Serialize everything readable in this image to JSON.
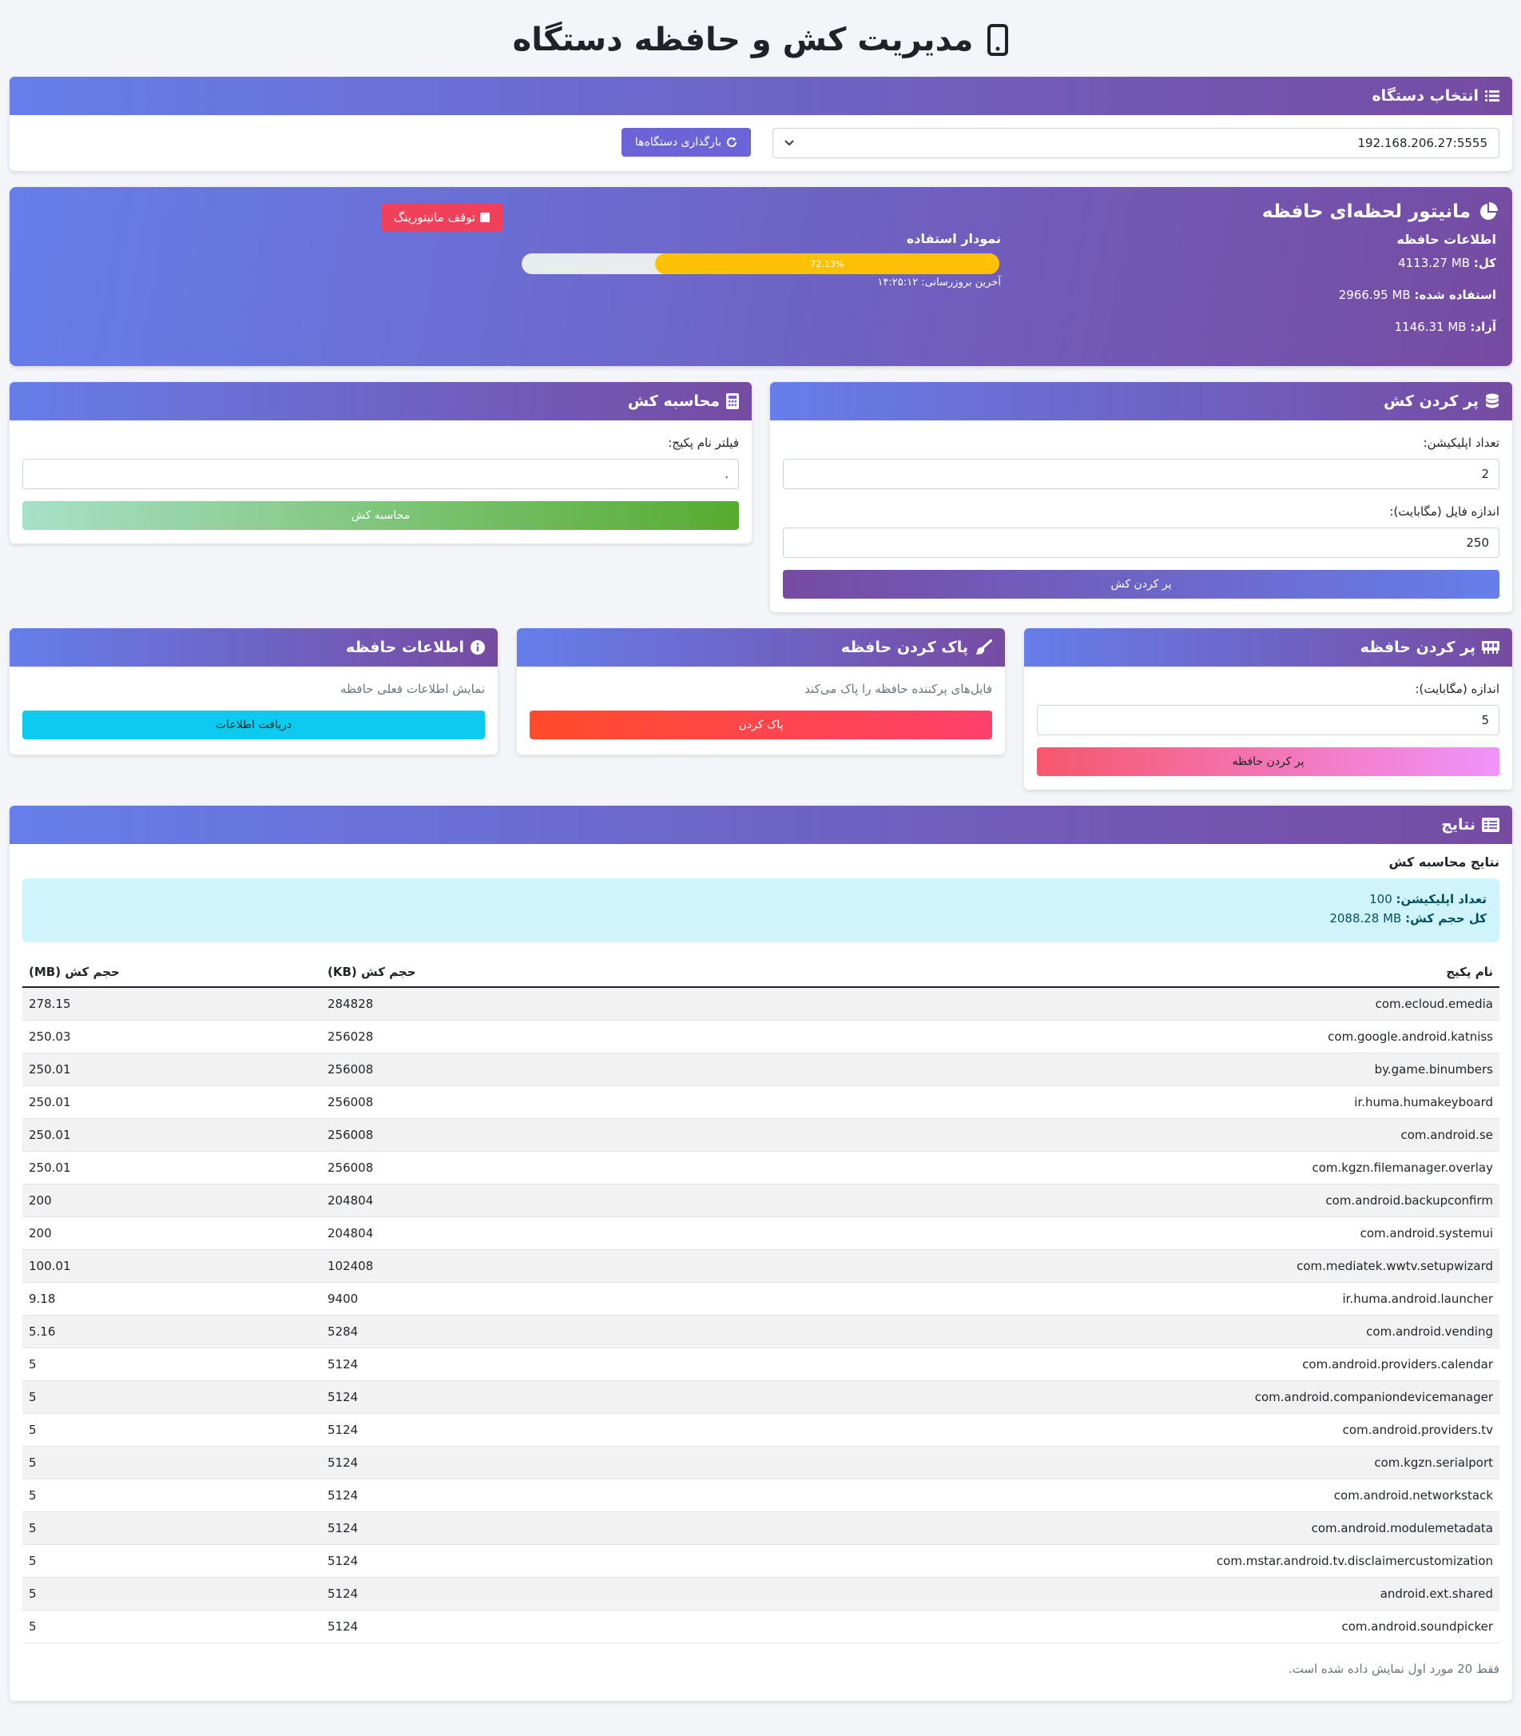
{
  "title": "مدیریت کش و حافظه دستگاه",
  "device": {
    "header": "انتخاب دستگاه",
    "selected": "192.168.206.27:5555",
    "reload_label": "بارگذاری دستگاه‌ها"
  },
  "monitor": {
    "title": "مانیتور لحظه‌ای حافظه",
    "info_heading": "اطلاعات حافظه",
    "total_label": "کل:",
    "total_value": "4113.27 MB",
    "used_label": "استفاده شده:",
    "used_value": "2966.95 MB",
    "free_label": "آزاد:",
    "free_value": "1146.31 MB",
    "chart_label": "نمودار استفاده",
    "usage_percent": 72.13,
    "usage_text": "72.13%",
    "last_update": "آخرین بروزرسانی: ۱۴:۲۵:۱۲",
    "stop_label": "توقف مانیتورینگ"
  },
  "fill_cache": {
    "header": "پر کردن کش",
    "app_count_label": "تعداد اپلیکیشن:",
    "app_count_value": "2",
    "file_size_label": "اندازه فایل (مگابایت):",
    "file_size_value": "250",
    "button": "پر کردن کش"
  },
  "calc_cache": {
    "header": "محاسبه کش",
    "filter_label": "فیلتر نام پکیج:",
    "filter_value": ".",
    "button": "محاسبه کش"
  },
  "fill_memory": {
    "header": "پر کردن حافظه",
    "size_label": "اندازه (مگابایت):",
    "size_value": "5",
    "button": "پر کردن حافظه"
  },
  "clear_memory": {
    "header": "پاک کردن حافظه",
    "description": "فایل‌های پرکننده حافظه را پاک می‌کند",
    "button": "پاک کردن"
  },
  "memory_info": {
    "header": "اطلاعات حافظه",
    "description": "نمایش اطلاعات فعلی حافظه",
    "button": "دریافت اطلاعات"
  },
  "results": {
    "header": "نتایج",
    "subtitle": "نتایج محاسبه کش",
    "app_count_label": "تعداد اپلیکیشن:",
    "app_count_value": "100",
    "total_label": "کل حجم کش:",
    "total_value": "2088.28 MB",
    "columns": [
      "نام پکیج",
      "حجم کش (KB)",
      "حجم کش (MB)"
    ],
    "rows": [
      [
        "com.ecloud.emedia",
        "284828",
        "278.15"
      ],
      [
        "com.google.android.katniss",
        "256028",
        "250.03"
      ],
      [
        "by.game.binumbers",
        "256008",
        "250.01"
      ],
      [
        "ir.huma.humakeyboard",
        "256008",
        "250.01"
      ],
      [
        "com.android.se",
        "256008",
        "250.01"
      ],
      [
        "com.kgzn.filemanager.overlay",
        "256008",
        "250.01"
      ],
      [
        "com.android.backupconfirm",
        "204804",
        "200"
      ],
      [
        "com.android.systemui",
        "204804",
        "200"
      ],
      [
        "com.mediatek.wwtv.setupwizard",
        "102408",
        "100.01"
      ],
      [
        "ir.huma.android.launcher",
        "9400",
        "9.18"
      ],
      [
        "com.android.vending",
        "5284",
        "5.16"
      ],
      [
        "com.android.providers.calendar",
        "5124",
        "5"
      ],
      [
        "com.android.companiondevicemanager",
        "5124",
        "5"
      ],
      [
        "com.android.providers.tv",
        "5124",
        "5"
      ],
      [
        "com.kgzn.serialport",
        "5124",
        "5"
      ],
      [
        "com.android.networkstack",
        "5124",
        "5"
      ],
      [
        "com.android.modulemetadata",
        "5124",
        "5"
      ],
      [
        "com.mstar.android.tv.disclaimercustomization",
        "5124",
        "5"
      ],
      [
        "android.ext.shared",
        "5124",
        "5"
      ],
      [
        "com.android.soundpicker",
        "5124",
        "5"
      ]
    ],
    "footer_note": "فقط 20 مورد اول نمایش داده شده است."
  },
  "colors": {
    "header_gradient_start": "#667eea",
    "header_gradient_end": "#764ba2",
    "progress_fill": "#ffc107",
    "stop_button": "#f0405a",
    "calc_button_start": "#56ab2f",
    "calc_button_end": "#a8e0c8",
    "clear_button_start": "#ff416c",
    "clear_button_end": "#ff4b2b",
    "info_button": "#0dcaf0",
    "fill_memory_button_start": "#f093fb",
    "fill_memory_button_end": "#f5576c",
    "results_alert_bg": "#cff4fc"
  },
  "icons": [
    "mobile-icon",
    "list-icon",
    "refresh-icon",
    "chevron-down-icon",
    "pie-chart-icon",
    "stop-icon",
    "database-icon",
    "calculator-icon",
    "memory-icon",
    "broom-icon",
    "info-icon",
    "table-icon"
  ]
}
